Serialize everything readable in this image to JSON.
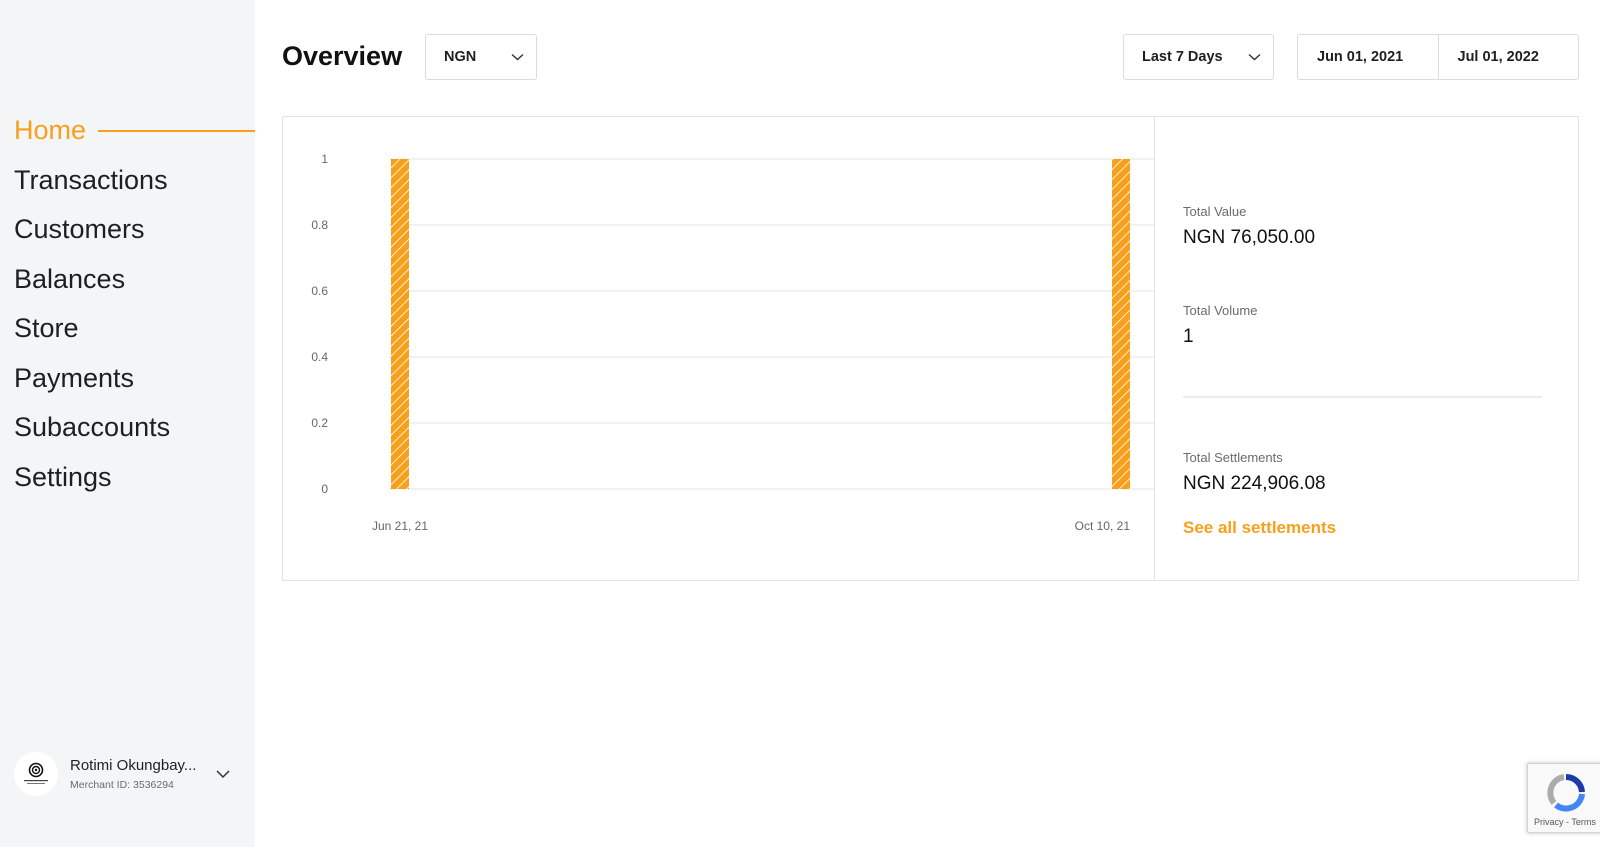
{
  "sidebar": {
    "items": [
      {
        "label": "Home",
        "active": true
      },
      {
        "label": "Transactions"
      },
      {
        "label": "Customers"
      },
      {
        "label": "Balances"
      },
      {
        "label": "Store"
      },
      {
        "label": "Payments"
      },
      {
        "label": "Subaccounts"
      },
      {
        "label": "Settings"
      }
    ],
    "account": {
      "name": "Rotimi Okungbay...",
      "merchant_id": "Merchant ID: 3536294",
      "avatar_icon": "brand-logo-icon"
    }
  },
  "header": {
    "title": "Overview",
    "currency": "NGN",
    "period": "Last 7 Days",
    "date_from": "Jun 01, 2021",
    "date_to": "Jul 01, 2022"
  },
  "chart_data": {
    "type": "bar",
    "categories": [
      "Jun 21, 21",
      "Oct 10, 21"
    ],
    "values": [
      1,
      1
    ],
    "y_ticks": [
      "0",
      "0.2",
      "0.4",
      "0.6",
      "0.8",
      "1"
    ],
    "ylim": [
      0,
      1
    ],
    "grid": true,
    "bar_color": "#f8a01c",
    "title": "",
    "xlabel": "",
    "ylabel": ""
  },
  "stats": {
    "total_value_label": "Total Value",
    "total_value": "NGN 76,050.00",
    "total_volume_label": "Total Volume",
    "total_volume": "1",
    "total_settlements_label": "Total Settlements",
    "total_settlements": "NGN 224,906.08",
    "see_all_link": "See all settlements"
  },
  "recaptcha": {
    "text": "Privacy - Terms"
  },
  "colors": {
    "accent": "#f8a01c",
    "sidebar_bg": "#f4f5f7"
  }
}
